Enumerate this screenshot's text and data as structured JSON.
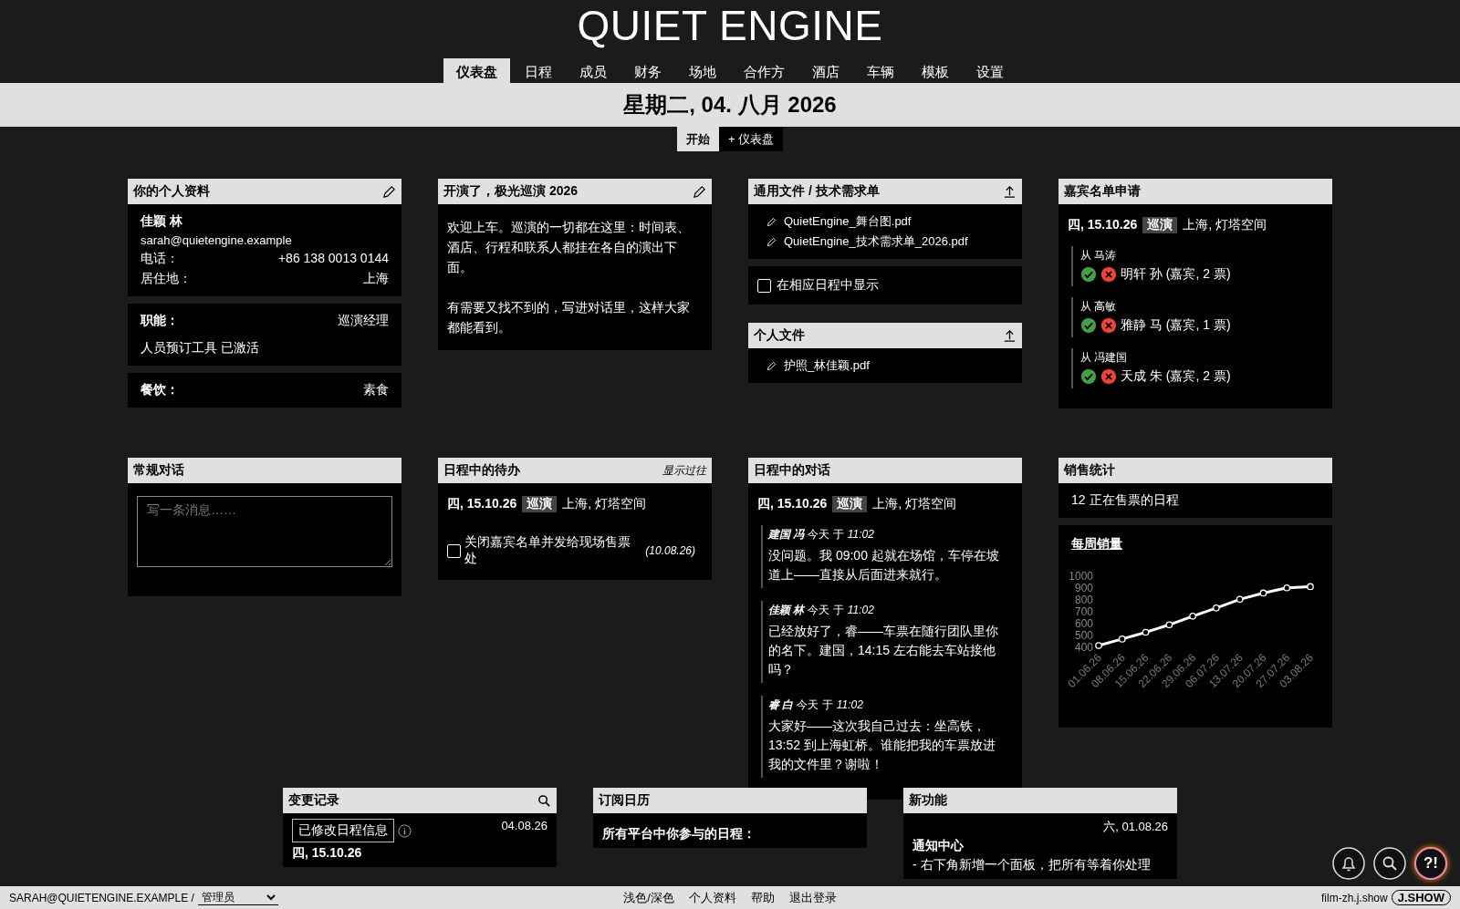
{
  "app": {
    "title": "QUIET ENGINE"
  },
  "tabs": [
    {
      "label": "仪表盘",
      "selected": true
    },
    {
      "label": "日程",
      "selected": false
    },
    {
      "label": "成员",
      "selected": false
    },
    {
      "label": "财务",
      "selected": false
    },
    {
      "label": "场地",
      "selected": false
    },
    {
      "label": "合作方",
      "selected": false
    },
    {
      "label": "酒店",
      "selected": false
    },
    {
      "label": "车辆",
      "selected": false
    },
    {
      "label": "模板",
      "selected": false
    },
    {
      "label": "设置",
      "selected": false
    }
  ],
  "date_bar": {
    "date": "星期二, 04. 八月 2026"
  },
  "subtabs": [
    {
      "label": "开始",
      "selected": true
    },
    {
      "label": "+ 仪表盘",
      "selected": false
    }
  ],
  "profile": {
    "title": "你的个人资料",
    "name": "佳颖 林",
    "email": "sarah@quietengine.example",
    "fields": [
      {
        "label": "电话：",
        "value": "+86 138 0013 0144"
      },
      {
        "label": "居住地：",
        "value": "上海"
      }
    ],
    "role": {
      "label": "职能：",
      "value": "巡演经理"
    },
    "tool_status": "人员预订工具 已激活",
    "diet": {
      "label": "餐饮：",
      "value": "素食"
    }
  },
  "welcome": {
    "title": "开演了，极光巡演 2026",
    "paragraphs": [
      "欢迎上车。巡演的一切都在这里：时间表、酒店、行程和联系人都挂在各自的演出下面。",
      "有需要又找不到的，写进对话里，这样大家都能看到。"
    ]
  },
  "general_files": {
    "title": "通用文件 / 技术需求单",
    "files": [
      "QuietEngine_舞台图.pdf",
      "QuietEngine_技术需求单_2026.pdf"
    ],
    "show_in_schedule": {
      "label": "在相应日程中显示",
      "checked": false
    }
  },
  "personal_files": {
    "title": "个人文件",
    "files": [
      "护照_林佳颖.pdf"
    ]
  },
  "guest_requests": {
    "title": "嘉宾名单申请",
    "event": {
      "day": "四, 15.10.26",
      "tag": "巡演",
      "place": "上海, 灯塔空间"
    },
    "requests": [
      {
        "from": "从 马涛",
        "guest": "明轩 孙 (嘉宾, 2 票)"
      },
      {
        "from": "从 高敏",
        "guest": "雅静 马 (嘉宾, 1 票)"
      },
      {
        "from": "从 冯建国",
        "guest": "天成 朱 (嘉宾, 2 票)"
      }
    ]
  },
  "general_chat": {
    "title": "常规对话",
    "placeholder": "写一条消息……"
  },
  "todos": {
    "title": "日程中的待办",
    "action": "显示过往",
    "event": {
      "day": "四, 15.10.26",
      "tag": "巡演",
      "place": "上海, 灯塔空间"
    },
    "items": [
      {
        "label": "关闭嘉宾名单并发给现场售票处",
        "date": "(10.08.26)",
        "checked": false
      }
    ]
  },
  "schedule_chat": {
    "title": "日程中的对话",
    "event": {
      "day": "四, 15.10.26",
      "tag": "巡演",
      "place": "上海, 灯塔空间"
    },
    "messages": [
      {
        "author": "建国 冯",
        "when": "今天 于",
        "time": "11:02",
        "text": "没问题。我 09:00 起就在场馆，车停在坡道上——直接从后面进来就行。"
      },
      {
        "author": "佳颖 林",
        "when": "今天 于",
        "time": "11:02",
        "text": "已经放好了，睿——车票在随行团队里你的名下。建国，14:15 左右能去车站接他吗？"
      },
      {
        "author": "睿 白",
        "when": "今天 于",
        "time": "11:02",
        "text": "大家好——这次我自己过去：坐高铁，13:52 到上海虹桥。谁能把我的车票放进我的文件里？谢啦！"
      }
    ]
  },
  "sales": {
    "title": "销售统计",
    "summary_count": "12",
    "summary_label": "正在售票的日程",
    "chart_data": {
      "type": "line",
      "title": "每周销量",
      "categories": [
        "01.06.26",
        "08.06.26",
        "15.06.26",
        "22.06.26",
        "29.06.26",
        "06.07.26",
        "13.07.26",
        "20.07.26",
        "27.07.26",
        "03.08.26"
      ],
      "series": [
        {
          "color": "#ffffff",
          "marker": "circle",
          "values": [
            415,
            470,
            527,
            590,
            663,
            732,
            805,
            858,
            902,
            912
          ]
        }
      ],
      "ylim": [
        400,
        1000
      ],
      "yticks": [
        400,
        500,
        600,
        700,
        800,
        900,
        1000
      ]
    }
  },
  "changelog": {
    "title": "变更记录",
    "entries": [
      {
        "label": "已修改日程信息",
        "date": "04.08.26"
      }
    ],
    "event_day": "四, 15.10.26"
  },
  "calendar": {
    "title": "订阅日历",
    "text": "所有平台中你参与的日程："
  },
  "news": {
    "title": "新功能",
    "date": "六, 01.08.26",
    "heading": "通知中心",
    "text": "- 右下角新增一个面板，把所有等着你处理"
  },
  "footer": {
    "user": "SARAH@QUIETENGINE.EXAMPLE /",
    "role": "管理员",
    "links": [
      "浅色/深色",
      "个人资料",
      "帮助",
      "退出登录"
    ],
    "site": "film-zh.j.show",
    "logo": "J.SHOW"
  },
  "fab": {
    "help": "?!"
  }
}
